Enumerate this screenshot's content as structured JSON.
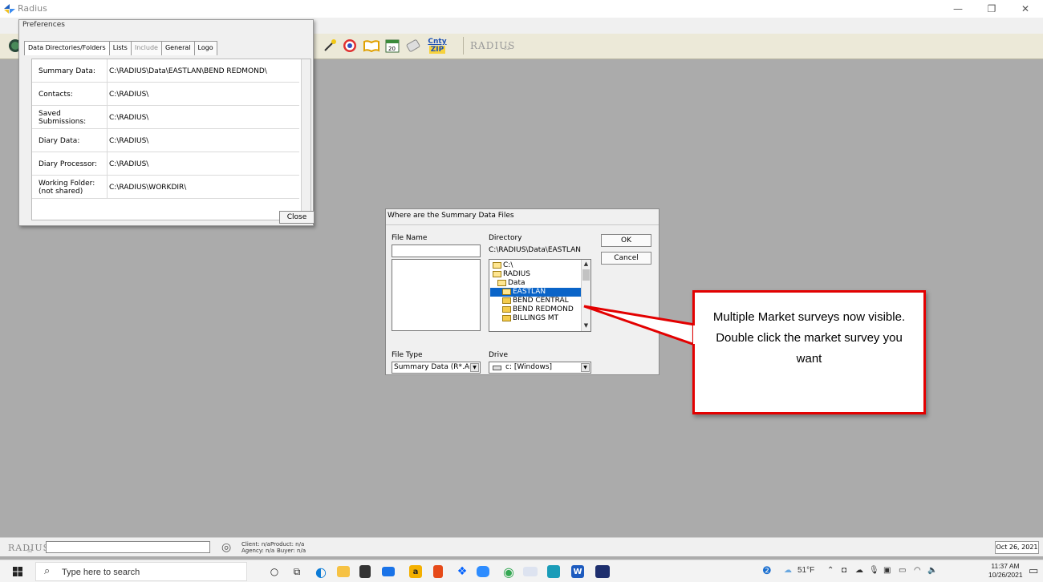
{
  "window": {
    "title": "Radius",
    "minimize_glyph": "—",
    "maximize_glyph": "❐",
    "close_glyph": "✕"
  },
  "toolbar": {
    "icons": [
      "wand-icon",
      "target-icon",
      "book-icon",
      "calendar-icon",
      "pen-icon",
      "county-zip-icon"
    ],
    "cnty_label": "Cnty",
    "zip_label": "ZIP",
    "logo_text": "RADIUS",
    "logo_sub": "32"
  },
  "preferences": {
    "title": "Preferences",
    "tabs": [
      {
        "label": "Data Directories/Folders",
        "state": "active"
      },
      {
        "label": "Lists",
        "state": "normal"
      },
      {
        "label": "Include",
        "state": "disabled"
      },
      {
        "label": "General",
        "state": "normal"
      },
      {
        "label": "Logo",
        "state": "normal"
      }
    ],
    "rows": [
      {
        "label": "Summary Data:",
        "value": "C:\\RADIUS\\Data\\EASTLAN\\BEND REDMOND\\"
      },
      {
        "label": "Contacts:",
        "value": "C:\\RADIUS\\"
      },
      {
        "label": "Saved Submissions:",
        "value": "C:\\RADIUS\\"
      },
      {
        "label": "Diary Data:",
        "value": "C:\\RADIUS\\"
      },
      {
        "label": "Diary Processor:",
        "value": "C:\\RADIUS\\"
      },
      {
        "label": "Working Folder: (not shared)",
        "value": "C:\\RADIUS\\WORKDIR\\"
      }
    ],
    "close_label": "Close"
  },
  "dialog": {
    "title": "Where are the Summary Data Files",
    "file_name_label": "File Name",
    "file_name_value": "",
    "directory_label": "Directory",
    "directory_path": "C:\\RADIUS\\Data\\EASTLAN",
    "ok_label": "OK",
    "cancel_label": "Cancel",
    "tree": [
      {
        "label": "C:\\",
        "indent": 0,
        "open": true,
        "selected": false
      },
      {
        "label": "RADIUS",
        "indent": 0,
        "open": true,
        "selected": false
      },
      {
        "label": "Data",
        "indent": 1,
        "open": true,
        "selected": false
      },
      {
        "label": "EASTLAN",
        "indent": 2,
        "open": true,
        "selected": true
      },
      {
        "label": "BEND CENTRAL",
        "indent": 3,
        "open": false,
        "selected": false
      },
      {
        "label": "BEND REDMOND",
        "indent": 3,
        "open": false,
        "selected": false
      },
      {
        "label": "BILLINGS MT",
        "indent": 3,
        "open": false,
        "selected": false
      }
    ],
    "file_type_label": "File Type",
    "file_type_value": "Summary Data (R*.A(",
    "drive_label": "Drive",
    "drive_value": "c: [Windows]"
  },
  "callout": {
    "text": "Multiple Market surveys now visible. Double click the market survey you want"
  },
  "statusbar": {
    "logo_text": "RADIUS",
    "logo_sub": "32",
    "client": "Client: n/a",
    "product": "Product: n/a",
    "agency": "Agency: n/a",
    "buyer": "Buyer: n/a",
    "date": "Oct 26, 2021"
  },
  "taskbar": {
    "search_placeholder": "Type here to search",
    "apps": [
      "cortana-icon",
      "task-view-icon",
      "edge-icon",
      "file-explorer-icon",
      "store-icon",
      "mail-icon",
      "amazon-icon",
      "office-icon",
      "dropbox-icon",
      "zoom-icon",
      "chrome-icon",
      "radius-app-icon",
      "webex-icon",
      "word-icon",
      "teams-icon"
    ],
    "amazon_letter": "a",
    "word_letter": "W",
    "weather": "51°F",
    "time": "11:37 AM",
    "date": "10/26/2021"
  }
}
